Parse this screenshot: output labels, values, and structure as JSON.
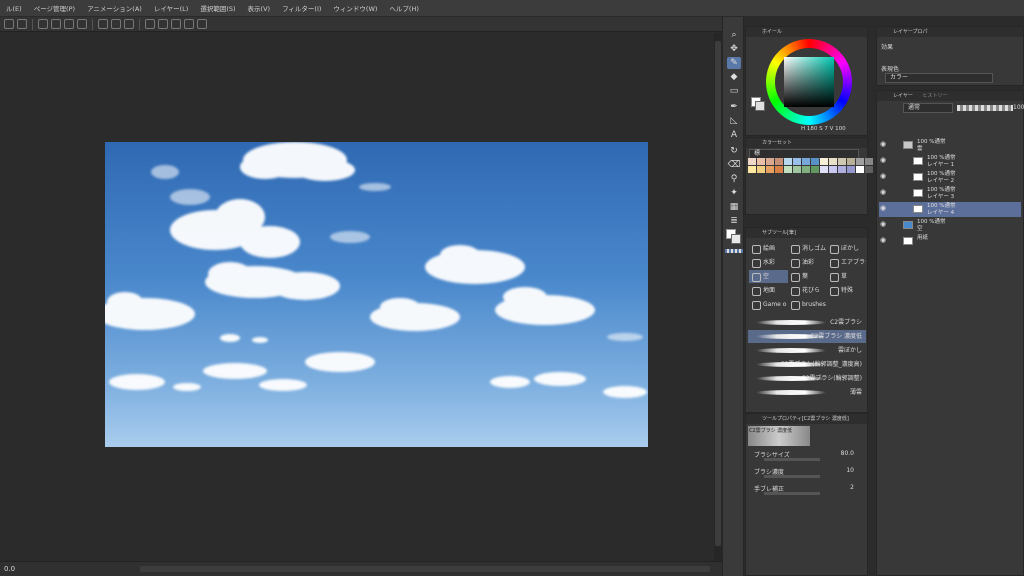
{
  "menu": [
    "ル(E)",
    "ページ管理(P)",
    "アニメーション(A)",
    "レイヤー(L)",
    "選択範囲(S)",
    "表示(V)",
    "フィルター(I)",
    "ウィンドウ(W)",
    "ヘルプ(H)"
  ],
  "color_panel": {
    "tab": "ホイール",
    "hsv": "180",
    "val2": "7",
    "val3": "100"
  },
  "palette_panel": {
    "tab": "カラーセット",
    "name": "標"
  },
  "subtool_panel": {
    "tab": "サブツール[筆]",
    "groups": [
      "絵画",
      "消しゴム",
      "ぼかし",
      "水彩",
      "油彩",
      "エアブラシ",
      "空",
      "葉",
      "草",
      "地面",
      "花びら",
      "特殊",
      "Game o",
      "brushes"
    ],
    "selected_group": "空",
    "brushes": [
      "C2雲ブラシ",
      "C2雲ブラシ 濃度低",
      "雲ぼかし",
      "C2雲ブラシ(輪郭調整_濃度高)",
      "C2雲ブラシ(輪郭調整)",
      "薄雲"
    ],
    "selected_brush": "C2雲ブラシ 濃度低"
  },
  "tool_property": {
    "tab": "ツールプロパティ[C2雲ブラシ 濃度低]",
    "preview": "C2雲ブラシ 濃度低",
    "props": [
      {
        "label": "ブラシサイズ",
        "value": "80.0"
      },
      {
        "label": "ブラシ濃度",
        "value": "10"
      },
      {
        "label": "手ブレ補正",
        "value": "2"
      }
    ]
  },
  "layer_property": {
    "tab": "レイヤープロパ",
    "effect_label": "効果",
    "color_label": "表現色",
    "color_value": "カラー"
  },
  "layers_panel": {
    "tab": "レイヤー",
    "tab2": "ヒストリー",
    "blend": "通常",
    "opacity": "100",
    "layers": [
      {
        "line1": "100 %通常",
        "line2": "雲",
        "kind": "folder"
      },
      {
        "line1": "100 %通常",
        "line2": "レイヤー 1",
        "kind": "raster"
      },
      {
        "line1": "100 %通常",
        "line2": "レイヤー 2",
        "kind": "raster"
      },
      {
        "line1": "100 %通常",
        "line2": "レイヤー 3",
        "kind": "raster"
      },
      {
        "line1": "100 %通常",
        "line2": "レイヤー 4",
        "kind": "raster",
        "selected": true
      },
      {
        "line1": "100 %通常",
        "line2": "空",
        "kind": "raster"
      },
      {
        "line1": "",
        "line2": "用紙",
        "kind": "paper"
      }
    ]
  },
  "status": {
    "zoom": "0.0"
  },
  "colors": {
    "accent": "#5c6f9a",
    "sky_top": "#2f69b3",
    "sky_bottom": "#a9cdee"
  }
}
